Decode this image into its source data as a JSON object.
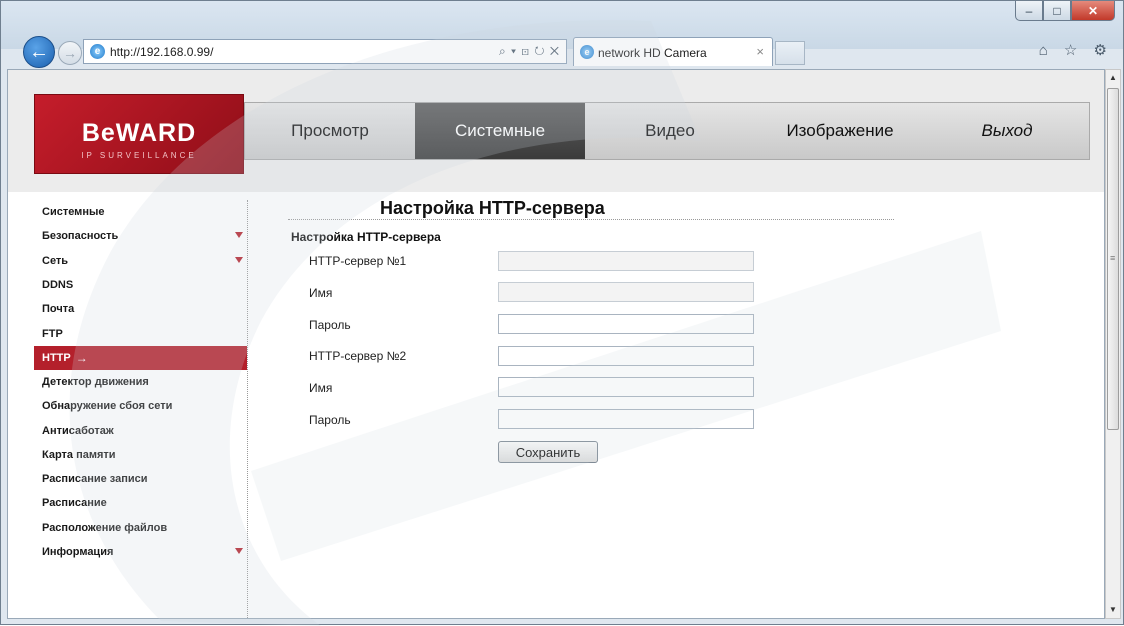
{
  "browser": {
    "address": "http://192.168.0.99/",
    "address_tools": "⌕ ▾ ⊡ ↻ ✕",
    "tab_title": "network HD Camera",
    "tab_close": "×",
    "right_icons": "⌂ ☆ ⚙"
  },
  "window_controls": {
    "min": "–",
    "max": "□",
    "close": "✕"
  },
  "logo": {
    "word": "BeWARD",
    "tagline": "IP SURVEILLANCE"
  },
  "menu": [
    {
      "label": "Просмотр"
    },
    {
      "label": "Системные"
    },
    {
      "label": "Видео"
    },
    {
      "label": "Изображение"
    },
    {
      "label": "Выход"
    }
  ],
  "sidebar": {
    "items": [
      {
        "label": "Системные"
      },
      {
        "label": "Безопасность"
      },
      {
        "label": "Сеть"
      },
      {
        "label": "DDNS"
      },
      {
        "label": "Почта"
      },
      {
        "label": "FTP"
      },
      {
        "label": "HTTP"
      },
      {
        "label": "Детектор движения"
      },
      {
        "label": "Обнаружение сбоя сети"
      },
      {
        "label": "Антисаботаж"
      },
      {
        "label": "Карта памяти"
      },
      {
        "label": "Расписание записи"
      },
      {
        "label": "Расписание"
      },
      {
        "label": "Расположение файлов"
      },
      {
        "label": "Информация"
      }
    ],
    "active_arrow": "→"
  },
  "page": {
    "title": "Настройка HTTP-сервера",
    "section_title": "Настройка HTTP-сервера",
    "fields": [
      {
        "label": "HTTP-сервер №1",
        "value": ""
      },
      {
        "label": "Имя",
        "value": ""
      },
      {
        "label": "Пароль",
        "value": ""
      },
      {
        "label": "HTTP-сервер №2",
        "value": ""
      },
      {
        "label": "Имя",
        "value": ""
      },
      {
        "label": "Пароль",
        "value": ""
      }
    ],
    "save_label": "Сохранить"
  }
}
